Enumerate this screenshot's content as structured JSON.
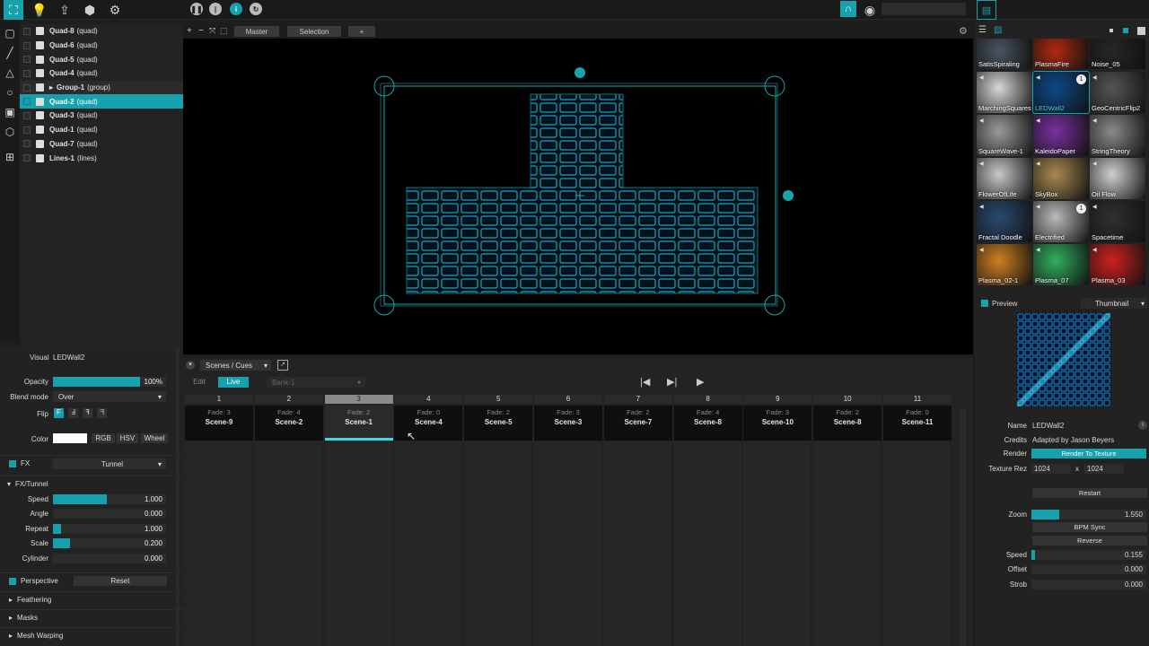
{
  "toolbar": {
    "tools": [
      "select-icon",
      "bulb-icon",
      "export-icon",
      "cubes-icon",
      "gear-icon"
    ]
  },
  "layers": [
    {
      "name": "Quad-8",
      "kind": "(quad)"
    },
    {
      "name": "Quad-6",
      "kind": "(quad)"
    },
    {
      "name": "Quad-5",
      "kind": "(quad)"
    },
    {
      "name": "Quad-4",
      "kind": "(quad)"
    },
    {
      "name": "Group-1",
      "kind": "(group)"
    },
    {
      "name": "Quad-2",
      "kind": "(quad)"
    },
    {
      "name": "Quad-3",
      "kind": "(quad)"
    },
    {
      "name": "Quad-1",
      "kind": "(quad)"
    },
    {
      "name": "Quad-7",
      "kind": "(quad)"
    },
    {
      "name": "Lines-1",
      "kind": "(lines)"
    }
  ],
  "canvas": {
    "tab_master": "Master",
    "tab_selection": "Selection",
    "tab_add": "+"
  },
  "props": {
    "visual_label": "Visual",
    "visual_value": "LEDWall2",
    "opacity_label": "Opacity",
    "opacity_value": "100%",
    "opacity_fraction": 1.0,
    "blend_label": "Blend mode",
    "blend_value": "Over",
    "flip_label": "Flip",
    "flip_opts": [
      "F",
      "Ⅎ",
      "ꟻ",
      "ᖷ"
    ],
    "color_label": "Color",
    "color_modes": [
      "RGB",
      "HSV",
      "Wheel"
    ],
    "fx_label": "FX",
    "fx_value": "Tunnel",
    "fx_section": "FX/Tunnel",
    "params": [
      {
        "label": "Speed",
        "value": "1.000",
        "fraction": 0.48
      },
      {
        "label": "Angle",
        "value": "0.000",
        "fraction": 0.0
      },
      {
        "label": "Repeat",
        "value": "1.000",
        "fraction": 0.07
      },
      {
        "label": "Scale",
        "value": "0.200",
        "fraction": 0.15
      },
      {
        "label": "Cylinder",
        "value": "0.000",
        "fraction": 0.0
      }
    ],
    "perspective_label": "Perspective",
    "reset_label": "Reset",
    "feathering_label": "Feathering",
    "masks_label": "Masks",
    "mesh_label": "Mesh Warping"
  },
  "cues": {
    "dropdown": "Scenes / Cues",
    "edit": "Edit",
    "live": "Live",
    "bank": "Bank-1",
    "columns": [
      {
        "num": "1",
        "fade": "Fade: 3",
        "name": "Scene-9"
      },
      {
        "num": "2",
        "fade": "Fade: 4",
        "name": "Scene-2"
      },
      {
        "num": "3",
        "fade": "Fade: 2",
        "name": "Scene-1"
      },
      {
        "num": "4",
        "fade": "Fade: 0",
        "name": "Scene-4"
      },
      {
        "num": "5",
        "fade": "Fade: 2",
        "name": "Scene-5"
      },
      {
        "num": "6",
        "fade": "Fade: 3",
        "name": "Scene-3"
      },
      {
        "num": "7",
        "fade": "Fade: 2",
        "name": "Scene-7"
      },
      {
        "num": "8",
        "fade": "Fade: 4",
        "name": "Scene-8"
      },
      {
        "num": "9",
        "fade": "Fade: 3",
        "name": "Scene-10"
      },
      {
        "num": "10",
        "fade": "Fade: 2",
        "name": "Scene-8"
      },
      {
        "num": "11",
        "fade": "Fade: 0",
        "name": "Scene-11"
      }
    ],
    "active_index": 2
  },
  "library": [
    {
      "name": "SatisSpiraling",
      "bg": "#4a5560"
    },
    {
      "name": "PlasmaFire",
      "bg": "#b02a10"
    },
    {
      "name": "Noise_05",
      "bg": "#262626"
    },
    {
      "name": "MarchingSquares",
      "bg": "#d8d8d8"
    },
    {
      "name": "LEDWall2",
      "bg": "#0c4a8a",
      "selected": true,
      "badge": "1"
    },
    {
      "name": "GeoCentricFlip2",
      "bg": "#555"
    },
    {
      "name": "SquareWave-1",
      "bg": "#9a9a9a"
    },
    {
      "name": "KaleidoPaper",
      "bg": "#7a30a0"
    },
    {
      "name": "StringTheory",
      "bg": "#8a8a8a"
    },
    {
      "name": "FlowerOfLife",
      "bg": "#c8c8c8"
    },
    {
      "name": "SkyBox",
      "bg": "#a88a50"
    },
    {
      "name": "Oil Flow",
      "bg": "#d0d0d0"
    },
    {
      "name": "Fractal Doodle",
      "bg": "#2a4a70",
      "badge": ""
    },
    {
      "name": "Electrified",
      "bg": "#bbbbbb",
      "badge": "1"
    },
    {
      "name": "Spacetime",
      "bg": "#303030"
    },
    {
      "name": "Plasma_02-1",
      "bg": "#d08020"
    },
    {
      "name": "Plasma_07",
      "bg": "#30b060"
    },
    {
      "name": "Plasma_03",
      "bg": "#d02020"
    }
  ],
  "inspector": {
    "preview_label": "Preview",
    "preview_mode": "Thumbnail",
    "name_label": "Name",
    "name_value": "LEDWall2",
    "credits_label": "Credits",
    "credits_value": "Adapted by Jason Beyers",
    "render_label": "Render",
    "render_value": "Render To Texture",
    "texrez_label": "Texture Rez",
    "tex_w": "1024",
    "tex_x": "x",
    "tex_h": "1024",
    "restart_label": "Restart",
    "zoom_label": "Zoom",
    "zoom_value": "1.550",
    "zoom_fraction": 0.24,
    "bpm_label": "BPM Sync",
    "reverse_label": "Reverse",
    "speed_label": "Speed",
    "speed_value": "0.155",
    "speed_fraction": 0.03,
    "offset_label": "Offset",
    "offset_value": "0.000",
    "strob_label": "Strob",
    "strob_value": "0.000"
  }
}
